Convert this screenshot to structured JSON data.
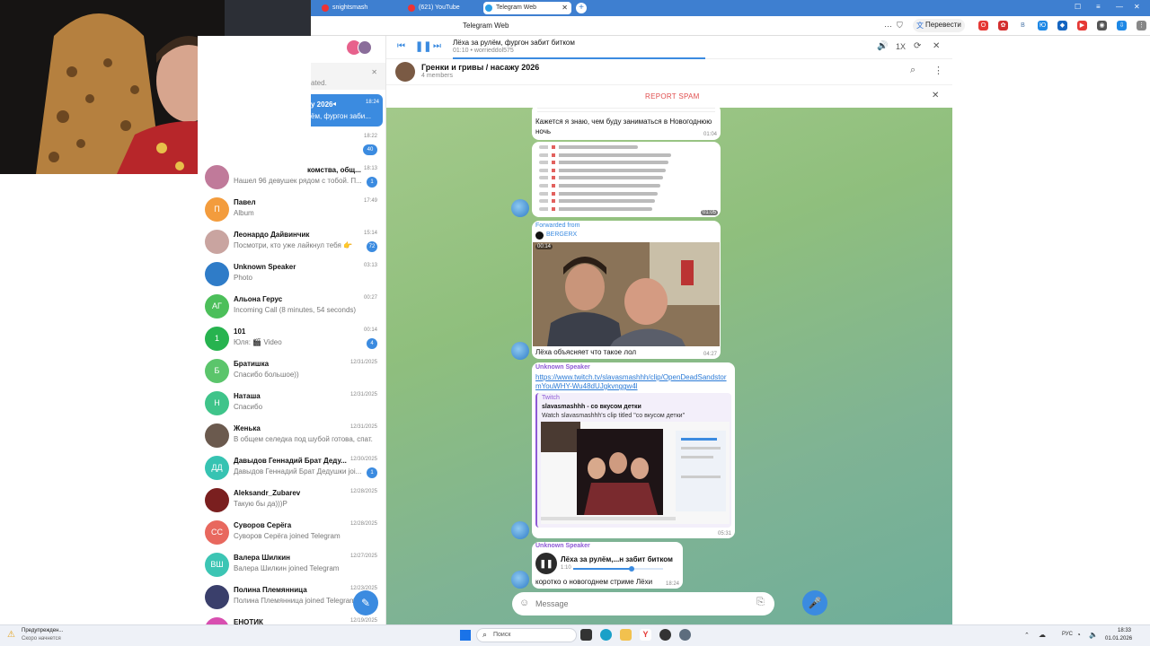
{
  "browser": {
    "tabs": [
      {
        "label": "snightsmash",
        "active": false
      },
      {
        "label": "(621) YouTube",
        "active": false
      },
      {
        "label": "Telegram Web",
        "active": true
      }
    ],
    "page_title": "Telegram Web",
    "translate_label": "Перевести"
  },
  "player": {
    "title": "Лёха за рулём, фургон забит битком",
    "subtitle": "01:10 • worrieddol575",
    "speed": "1X"
  },
  "chat_header": {
    "title": "Гренки и гривы / насажу 2026",
    "members": "4 members"
  },
  "spam_bar": {
    "label": "REPORT SPAM"
  },
  "sidebar": {
    "partial": [
      {
        "text": "ated."
      },
      {
        "title": "y 2026",
        "preview": "ём, фургон заби...",
        "time": "18:24"
      },
      {
        "time": "18:22",
        "badge": "40"
      },
      {
        "title": "комства, общ...",
        "preview": "Нашел 96 девушек рядом с тобой. П...",
        "time": "18:13",
        "badge": "1"
      }
    ],
    "chats": [
      {
        "name": "Павел",
        "preview": "Album",
        "time": "17:49",
        "badge": "",
        "avatar": "П",
        "color": "#f39c3d"
      },
      {
        "name": "Леонардо Дайвинчик",
        "preview": "Посмотри, кто уже лайкнул тебя 👉",
        "time": "15:14",
        "badge": "72",
        "avatar": "",
        "color": "#c9a4a0"
      },
      {
        "name": "Unknown Speaker",
        "preview": "Photo",
        "time": "03:13",
        "badge": "",
        "avatar": "",
        "color": "#2f7cc8"
      },
      {
        "name": "Альона Герус",
        "preview": "Incoming Call (8 minutes, 54 seconds)",
        "time": "00:27",
        "badge": "",
        "avatar": "АГ",
        "color": "#4cbf5a"
      },
      {
        "name": "101",
        "preview": "Юля: 🎬 Video",
        "time": "00:14",
        "badge": "4",
        "avatar": "1",
        "color": "#27b34f"
      },
      {
        "name": "Братишка",
        "preview": "Спасибо большое))",
        "time": "12/31/2025",
        "badge": "",
        "avatar": "Б",
        "color": "#5bc56b"
      },
      {
        "name": "Наташа",
        "preview": "Спасибо",
        "time": "12/31/2025",
        "badge": "",
        "avatar": "Н",
        "color": "#3fc48a"
      },
      {
        "name": "Женька",
        "preview": "В общем селедка под шубой готова, спат...",
        "time": "12/31/2025",
        "badge": "",
        "avatar": "",
        "color": "#6b5a4e"
      },
      {
        "name": "Давыдов Геннадий Брат Деду...",
        "preview": "Давыдов Геннадий Брат Дедушки joi...",
        "time": "12/30/2025",
        "badge": "1",
        "avatar": "ДД",
        "color": "#36c3b2"
      },
      {
        "name": "Aleksandr_Zubarev",
        "preview": "Такую бы да)))Р",
        "time": "12/28/2025",
        "badge": "",
        "avatar": "",
        "color": "#7a1f1f"
      },
      {
        "name": "Суворов Серёга",
        "preview": "Суворов Серёга joined Telegram",
        "time": "12/28/2025",
        "badge": "",
        "avatar": "СС",
        "color": "#e8685e"
      },
      {
        "name": "Валера Шилкин",
        "preview": "Валера Шилкин joined Telegram",
        "time": "12/27/2025",
        "badge": "",
        "avatar": "ВШ",
        "color": "#3cc5b4"
      },
      {
        "name": "Полина Племянница",
        "preview": "Полина Племянница joined Telegram",
        "time": "12/23/2025",
        "badge": "",
        "avatar": "",
        "color": "#3a3f6b"
      },
      {
        "name": "ЕНОТИК",
        "preview": "",
        "time": "12/19/2025",
        "badge": "",
        "avatar": "",
        "color": "#d84fb0"
      }
    ]
  },
  "messages": {
    "m1_text": "Кажется я знаю, чем буду заниматься в Новогоднюю ночь",
    "m1_time": "01:04",
    "m2_time": "01:05",
    "m3_forwarded": "Forwarded from",
    "m3_from": "BERGERX",
    "m3_video_time": "00:14",
    "m3_text": "Лёха объясняет что такое лол",
    "m3_time": "04:27",
    "m4_sender": "Unknown Speaker",
    "m4_link": "https://www.twitch.tv/slavasmashhh/clip/OpenDeadSandstormYouWHY-Wu48dUJgkvnggw4l",
    "m4_site": "Twitch",
    "m4_title": "slavasmashhh - со вкусом детки",
    "m4_desc": "Watch slavasmashhh's clip titled \"со вкусом детки\"",
    "m4_time": "05:31",
    "m5_sender": "Unknown Speaker",
    "m5_audio_title": "Лёха за рулём,...н забит битком",
    "m5_audio_time": "1:10",
    "m5_text": "коротко о новогоднем стриме Лёхи",
    "m5_time": "18:24"
  },
  "composer": {
    "placeholder": "Message"
  },
  "taskbar": {
    "notify_title": "Предупрежден...",
    "notify_sub": "Скоро начнется",
    "search": "Поиск",
    "lang": "РУС",
    "time": "18:33",
    "date": "01.01.2026"
  },
  "colors": {
    "accent": "#3b8be0",
    "tabbar": "#3e7fd0",
    "spam": "#e04e4e"
  }
}
